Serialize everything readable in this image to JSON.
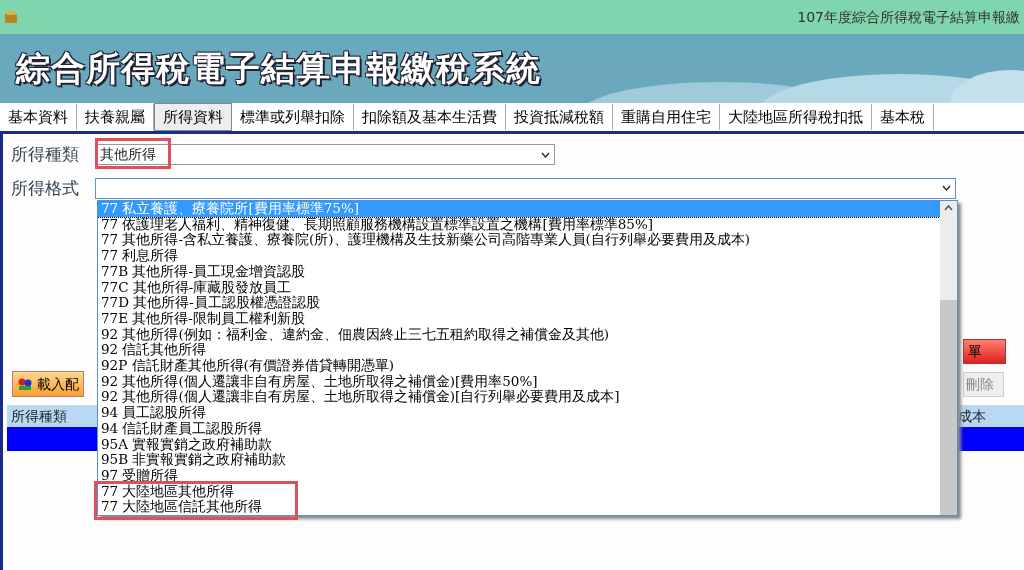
{
  "window": {
    "title": "107年度綜合所得稅電子結算申報繳"
  },
  "banner": {
    "title": "綜合所得稅電子結算申報繳稅系統"
  },
  "tabs": [
    {
      "label": "基本資料",
      "selected": false
    },
    {
      "label": "扶養親屬",
      "selected": false
    },
    {
      "label": "所得資料",
      "selected": true
    },
    {
      "label": "標準或列舉扣除",
      "selected": false
    },
    {
      "label": "扣除額及基本生活費",
      "selected": false
    },
    {
      "label": "投資抵減稅額",
      "selected": false
    },
    {
      "label": "重購自用住宅",
      "selected": false
    },
    {
      "label": "大陸地區所得稅扣抵",
      "selected": false
    },
    {
      "label": "基本稅",
      "selected": false
    }
  ],
  "form": {
    "income_type": {
      "label": "所得種類",
      "value": "其他所得",
      "highlighted": true
    },
    "income_format": {
      "label": "所得格式",
      "expanded": true
    }
  },
  "options": [
    {
      "text": "77  私立養護、療養院所[費用率標準75%]",
      "selected": true,
      "highlighted": false
    },
    {
      "text": "77  依護理老人福利、精神復健、長期照顧服務機構設置標準設置之機構[費用率標準85%]",
      "selected": false,
      "highlighted": false
    },
    {
      "text": "77  其他所得-含私立養護、療養院(所)、護理機構及生技新藥公司高階專業人員(自行列舉必要費用及成本)",
      "selected": false,
      "highlighted": false
    },
    {
      "text": "77  利息所得",
      "selected": false,
      "highlighted": false
    },
    {
      "text": "77B  其他所得-員工現金增資認股",
      "selected": false,
      "highlighted": false
    },
    {
      "text": "77C  其他所得-庫藏股發放員工",
      "selected": false,
      "highlighted": false
    },
    {
      "text": "77D  其他所得-員工認股權憑證認股",
      "selected": false,
      "highlighted": false
    },
    {
      "text": "77E  其他所得-限制員工權利新股",
      "selected": false,
      "highlighted": false
    },
    {
      "text": "92  其他所得(例如：福利金、違約金、佃農因終止三七五租約取得之補償金及其他)",
      "selected": false,
      "highlighted": false
    },
    {
      "text": "92  信託其他所得",
      "selected": false,
      "highlighted": false
    },
    {
      "text": "92P  信託財產其他所得(有價證券借貸轉開憑單)",
      "selected": false,
      "highlighted": false
    },
    {
      "text": "92  其他所得(個人遷讓非自有房屋、土地所取得之補償金)[費用率50%]",
      "selected": false,
      "highlighted": false
    },
    {
      "text": "92  其他所得(個人遷讓非自有房屋、土地所取得之補償金)[自行列舉必要費用及成本]",
      "selected": false,
      "highlighted": false
    },
    {
      "text": "94  員工認股所得",
      "selected": false,
      "highlighted": false
    },
    {
      "text": "94  信託財產員工認股所得",
      "selected": false,
      "highlighted": false
    },
    {
      "text": "95A  實報實銷之政府補助款",
      "selected": false,
      "highlighted": false
    },
    {
      "text": "95B  非實報實銷之政府補助款",
      "selected": false,
      "highlighted": false
    },
    {
      "text": "97  受贈所得",
      "selected": false,
      "highlighted": false
    },
    {
      "text": "77  大陸地區其他所得",
      "selected": false,
      "highlighted": true
    },
    {
      "text": "77  大陸地區信託其他所得",
      "selected": false,
      "highlighted": true
    }
  ],
  "buttons": {
    "load": {
      "label": "載入配"
    },
    "report": {
      "label": "單"
    },
    "delete": {
      "label": "刪除",
      "disabled": true
    }
  },
  "table": {
    "columns": [
      {
        "label": "所得種類"
      },
      {
        "label": "成本"
      }
    ]
  }
}
